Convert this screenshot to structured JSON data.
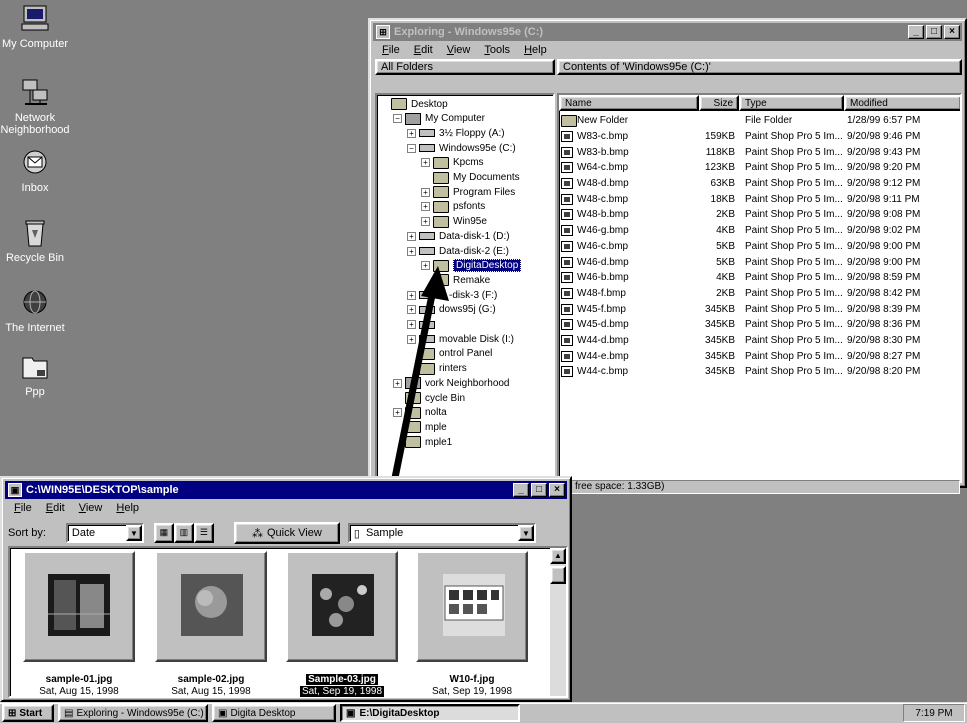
{
  "desktop": {
    "icons": [
      {
        "label": "My Computer",
        "icon": "my-computer-icon"
      },
      {
        "label": "Network Neighborhood",
        "icon": "network-icon"
      },
      {
        "label": "Inbox",
        "icon": "inbox-icon"
      },
      {
        "label": "Recycle Bin",
        "icon": "recycle-bin-icon"
      },
      {
        "label": "The Internet",
        "icon": "internet-icon"
      },
      {
        "label": "Ppp",
        "icon": "dialup-icon"
      }
    ]
  },
  "explorer": {
    "title": "Exploring - Windows95e (C:)",
    "menu": [
      "File",
      "Edit",
      "View",
      "Tools",
      "Help"
    ],
    "folders_header": "All Folders",
    "contents_header": "Contents of 'Windows95e (C:)'",
    "status_free": "free space: 1.33GB)",
    "tree": [
      {
        "label": "Desktop",
        "icon": "desktop"
      },
      {
        "label": "My Computer",
        "icon": "computer"
      },
      {
        "label": "3½ Floppy (A:)",
        "icon": "drive"
      },
      {
        "label": "Windows95e (C:)",
        "icon": "drive"
      },
      {
        "label": "Kpcms",
        "icon": "folder"
      },
      {
        "label": "My Documents",
        "icon": "folder"
      },
      {
        "label": "Program Files",
        "icon": "folder"
      },
      {
        "label": "psfonts",
        "icon": "folder"
      },
      {
        "label": "Win95e",
        "icon": "folder"
      },
      {
        "label": "Data-disk-1 (D:)",
        "icon": "drive"
      },
      {
        "label": "Data-disk-2 (E:)",
        "icon": "drive"
      },
      {
        "label": "DigitaDesktop",
        "icon": "folder"
      },
      {
        "label": "Remake",
        "icon": "folder"
      },
      {
        "label": "D -disk-3 (F:)",
        "icon": "drive"
      },
      {
        "label": "dows95j (G:)",
        "icon": "drive"
      },
      {
        "label": "",
        "icon": "drive"
      },
      {
        "label": "movable Disk (I:)",
        "icon": "drive"
      },
      {
        "label": "ontrol Panel",
        "icon": "folder"
      },
      {
        "label": "rinters",
        "icon": "folder"
      },
      {
        "label": "vork Neighborhood",
        "icon": "computer"
      },
      {
        "label": "cycle Bin",
        "icon": "folder"
      },
      {
        "label": "nolta",
        "icon": "folder"
      },
      {
        "label": "mple",
        "icon": "folder"
      },
      {
        "label": "mple1",
        "icon": "folder"
      }
    ],
    "columns": [
      "Name",
      "Size",
      "Type",
      "Modified"
    ],
    "files": [
      {
        "name": "New Folder",
        "size": "",
        "type": "File Folder",
        "modified": "1/28/99 6:57 PM",
        "folder": true
      },
      {
        "name": "W83-c.bmp",
        "size": "159KB",
        "type": "Paint Shop Pro 5 Im...",
        "modified": "9/20/98 9:46 PM"
      },
      {
        "name": "W83-b.bmp",
        "size": "118KB",
        "type": "Paint Shop Pro 5 Im...",
        "modified": "9/20/98 9:43 PM"
      },
      {
        "name": "W64-c.bmp",
        "size": "123KB",
        "type": "Paint Shop Pro 5 Im...",
        "modified": "9/20/98 9:20 PM"
      },
      {
        "name": "W48-d.bmp",
        "size": "63KB",
        "type": "Paint Shop Pro 5 Im...",
        "modified": "9/20/98 9:12 PM"
      },
      {
        "name": "W48-c.bmp",
        "size": "18KB",
        "type": "Paint Shop Pro 5 Im...",
        "modified": "9/20/98 9:11 PM"
      },
      {
        "name": "W48-b.bmp",
        "size": "2KB",
        "type": "Paint Shop Pro 5 Im...",
        "modified": "9/20/98 9:08 PM"
      },
      {
        "name": "W46-g.bmp",
        "size": "4KB",
        "type": "Paint Shop Pro 5 Im...",
        "modified": "9/20/98 9:02 PM"
      },
      {
        "name": "W46-c.bmp",
        "size": "5KB",
        "type": "Paint Shop Pro 5 Im...",
        "modified": "9/20/98 9:00 PM"
      },
      {
        "name": "W46-d.bmp",
        "size": "5KB",
        "type": "Paint Shop Pro 5 Im...",
        "modified": "9/20/98 9:00 PM"
      },
      {
        "name": "W46-b.bmp",
        "size": "4KB",
        "type": "Paint Shop Pro 5 Im...",
        "modified": "9/20/98 8:59 PM"
      },
      {
        "name": "W48-f.bmp",
        "size": "2KB",
        "type": "Paint Shop Pro 5 Im...",
        "modified": "9/20/98 8:42 PM"
      },
      {
        "name": "W45-f.bmp",
        "size": "345KB",
        "type": "Paint Shop Pro 5 Im...",
        "modified": "9/20/98 8:39 PM"
      },
      {
        "name": "W45-d.bmp",
        "size": "345KB",
        "type": "Paint Shop Pro 5 Im...",
        "modified": "9/20/98 8:36 PM"
      },
      {
        "name": "W44-d.bmp",
        "size": "345KB",
        "type": "Paint Shop Pro 5 Im...",
        "modified": "9/20/98 8:30 PM"
      },
      {
        "name": "W44-e.bmp",
        "size": "345KB",
        "type": "Paint Shop Pro 5 Im...",
        "modified": "9/20/98 8:27 PM"
      },
      {
        "name": "W44-c.bmp",
        "size": "345KB",
        "type": "Paint Shop Pro 5 Im...",
        "modified": "9/20/98 8:20 PM"
      }
    ]
  },
  "sample": {
    "title": "C:\\WIN95E\\DESKTOP\\sample",
    "menu": [
      "File",
      "Edit",
      "View",
      "Help"
    ],
    "sort_label": "Sort by:",
    "sort_value": "Date",
    "quickview_label": "Quick View",
    "folder_value": "Sample",
    "thumbs": [
      {
        "name": "sample-01.jpg",
        "date": "Sat, Aug 15, 1998",
        "selected": false
      },
      {
        "name": "sample-02.jpg",
        "date": "Sat, Aug 15, 1998",
        "selected": false
      },
      {
        "name": "Sample-03.jpg",
        "date": "Sat, Sep 19, 1998",
        "selected": true
      },
      {
        "name": "W10-f.jpg",
        "date": "Sat, Sep 19, 1998",
        "selected": false
      }
    ]
  },
  "taskbar": {
    "start": "Start",
    "tasks": [
      "Exploring - Windows95e (C:)",
      "Digita Desktop",
      "E:\\DigitaDesktop"
    ],
    "clock": "7:19 PM"
  }
}
